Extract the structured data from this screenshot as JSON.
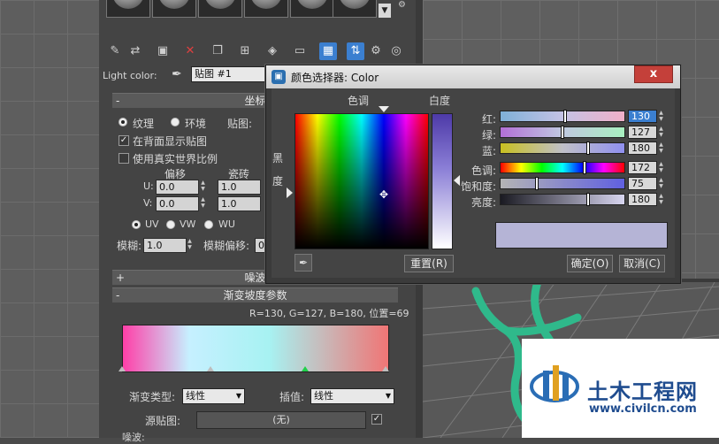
{
  "material_editor": {
    "light_color_label": "Light color:",
    "map_name": "贴图 #1",
    "coordinates_title": "坐标",
    "texture_label": "纹理",
    "environment_label": "环境",
    "mapping_label": "贴图:",
    "show_map_on_back": "在背面显示贴图",
    "use_real_world_scale": "使用真实世界比例",
    "offset_label": "偏移",
    "tiling_label": "瓷砖",
    "u_label": "U:",
    "v_label": "V:",
    "u_offset": "0.0",
    "v_offset": "0.0",
    "u_tiling": "1.0",
    "v_tiling": "1.0",
    "uv_label": "UV",
    "vw_label": "VW",
    "wu_label": "WU",
    "blur_label": "模糊:",
    "blur_value": "1.0",
    "blur_offset_label": "模糊偏移:",
    "blur_offset_value": "0.",
    "noise_title": "噪波",
    "gradient_ramp_title": "渐变坡度参数",
    "gradient_info": "R=130, G=127, B=180, 位置=69",
    "gradient_type_label": "渐变类型:",
    "gradient_type_value": "线性",
    "interpolation_label": "插值:",
    "interpolation_value": "线性",
    "source_map_label": "源贴图:",
    "source_map_value": "(无)",
    "noise_sub_label": "噪波:"
  },
  "color_dialog": {
    "title": "颜色选择器: Color",
    "hue_label": "色调",
    "whiteness_label": "白度",
    "blackness_label_top": "黑",
    "blackness_label_bottom": "度",
    "red_label": "红:",
    "green_label": "绿:",
    "blue_label": "蓝:",
    "hue_row_label": "色调:",
    "saturation_label": "饱和度:",
    "value_label": "亮度:",
    "red": "130",
    "green": "127",
    "blue": "180",
    "hue": "172",
    "saturation": "75",
    "value": "180",
    "reset_button": "重置(R)",
    "ok_button": "确定(O)",
    "cancel_button": "取消(C)",
    "close_glyph": "x",
    "swatch_color": "#8280b4"
  },
  "watermark": {
    "brand": "土木工程网",
    "url": "www.civilcn.com"
  }
}
